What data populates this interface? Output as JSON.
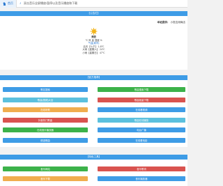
{
  "topbar": {
    "home_label": "首页",
    "ticker_text": "双击音乐全屏播放/暂停以及音乐播放和下载"
  },
  "info_section": {
    "title": "【公告栏】",
    "webmaster_label": "本站提供：",
    "webmaster_value": "小发应用商店",
    "weather": {
      "city": "黄陂",
      "temp_line": "℃  风 量  湿度 %",
      "status_line": "气温(城市)",
      "forecast": [
        "后天【七夕】 1-8℃",
        "大雨【星期六】 24℃",
        "小雨【星期日】 47℃"
      ]
    }
  },
  "tools_section": {
    "title": "【官方推荐】",
    "left_buttons": [
      {
        "label": "歌名搜索",
        "color": "blue"
      },
      {
        "label": "歌曲(视频)大全",
        "color": "cyan"
      },
      {
        "label": "在线听歌",
        "color": "orange"
      },
      {
        "label": "抖音热门歌曲",
        "color": "red"
      },
      {
        "label": "在线音乐播放器",
        "color": "green"
      },
      {
        "label": "精选歌曲",
        "color": "blue"
      }
    ],
    "right_buttons": [
      {
        "label": "歌曲搜索下载",
        "color": "green"
      },
      {
        "label": "歌曲批量下载",
        "color": "red"
      },
      {
        "label": "在线看视频",
        "color": "blue"
      },
      {
        "label": "歌曲在线播放",
        "color": "cyan"
      },
      {
        "label": "电台广播",
        "color": "blue"
      },
      {
        "label": "在线看电影",
        "color": "blue"
      }
    ]
  },
  "fun_section": {
    "title": "【特色工具】",
    "left_buttons": [
      {
        "label": "音乐网站",
        "color": "green"
      },
      {
        "label": "音乐下载",
        "color": "orange"
      }
    ],
    "right_buttons": [
      {
        "label": "音乐歌词",
        "color": "red"
      },
      {
        "label": "音乐播放器",
        "color": "blue"
      }
    ]
  }
}
